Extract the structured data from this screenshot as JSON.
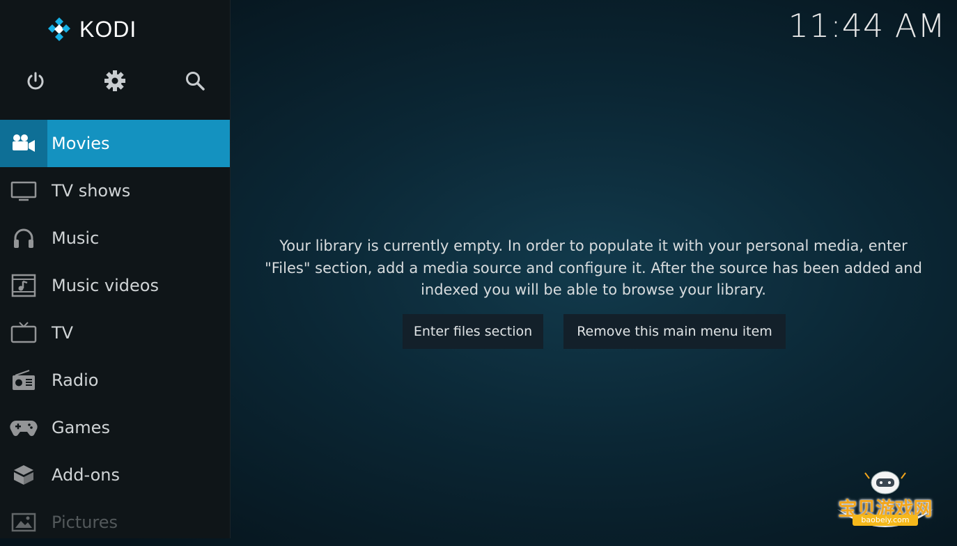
{
  "app": {
    "name": "KODI"
  },
  "clock": "11:44 AM",
  "top_icons": [
    {
      "name": "power-icon"
    },
    {
      "name": "gear-icon"
    },
    {
      "name": "search-icon"
    }
  ],
  "menu": [
    {
      "label": "Movies",
      "icon": "movie-camera-icon",
      "active": true
    },
    {
      "label": "TV shows",
      "icon": "monitor-icon"
    },
    {
      "label": "Music",
      "icon": "headphones-icon"
    },
    {
      "label": "Music videos",
      "icon": "music-video-icon"
    },
    {
      "label": "TV",
      "icon": "tv-icon"
    },
    {
      "label": "Radio",
      "icon": "radio-icon"
    },
    {
      "label": "Games",
      "icon": "gamepad-icon"
    },
    {
      "label": "Add-ons",
      "icon": "box-icon"
    },
    {
      "label": "Pictures",
      "icon": "picture-icon"
    }
  ],
  "main": {
    "message_lines": [
      "Your library is currently empty. In order to populate it with your personal media, enter",
      "\"Files\" section, add a media source and configure it. After the source has been added and",
      "indexed you will be able to browse your library."
    ],
    "enter_button": "Enter files section",
    "remove_button": "Remove this main menu item"
  },
  "watermark": {
    "text": "宝贝游戏网",
    "url": "baobeiy.com"
  },
  "colors": {
    "accent": "#1492c0",
    "accent_dark": "#0e6f96",
    "sidebar": "#0f1518"
  }
}
